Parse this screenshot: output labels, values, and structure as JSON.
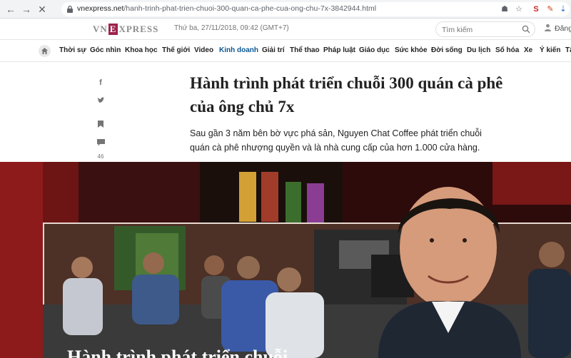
{
  "browser": {
    "url_domain": "vnexpress.net",
    "url_path": "/hanh-trinh-phat-trien-chuoi-300-quan-ca-phe-cua-ong-chu-7x-3842944.html"
  },
  "header": {
    "logo_left": "VN",
    "logo_e": "E",
    "logo_right": "XPRESS",
    "date": "Thứ ba, 27/11/2018, 09:42 (GMT+7)",
    "search_placeholder": "Tìm kiếm",
    "login": "Đăng"
  },
  "nav": {
    "items": [
      {
        "label": "Thời sự"
      },
      {
        "label": "Góc nhìn"
      },
      {
        "label": "Khoa học"
      },
      {
        "label": "Thế giới"
      },
      {
        "label": "Video"
      },
      {
        "label": "Kinh doanh"
      },
      {
        "label": "Giải trí"
      },
      {
        "label": "Thể thao"
      },
      {
        "label": "Pháp luật"
      },
      {
        "label": "Giáo dục"
      },
      {
        "label": "Sức khỏe"
      },
      {
        "label": "Đời sống"
      },
      {
        "label": "Du lịch"
      },
      {
        "label": "Số hóa"
      },
      {
        "label": "Xe"
      },
      {
        "label": "Ý kiến"
      },
      {
        "label": "Tâ"
      }
    ],
    "active": "Kinh doanh"
  },
  "social": {
    "comment_count": "46"
  },
  "article": {
    "title": "Hành trình phát triển chuỗi 300 quán cà phê của ông chủ 7x",
    "lead": "Sau gần 3 năm bên bờ vực phá sản, Nguyen Chat Coffee phát triển chuỗi quán cà phê nhượng quyền và là nhà cung cấp của hơn 1.000 cửa hàng.",
    "hero_overlay_title": "Hành trình phát triển chuỗi"
  },
  "colors": {
    "brand": "#9f224e",
    "nav_active": "#0a5694",
    "hero_bg": "#2a0c0c"
  }
}
